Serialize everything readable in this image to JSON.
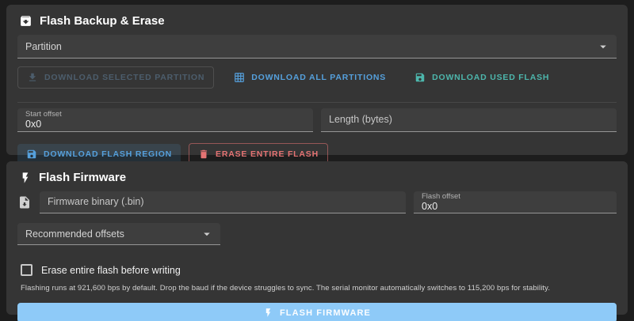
{
  "backup": {
    "title": "Flash Backup & Erase",
    "partition": {
      "label": "Partition"
    },
    "download_selected_label": "DOWNLOAD SELECTED PARTITION",
    "download_all_label": "DOWNLOAD ALL PARTITIONS",
    "download_used_label": "DOWNLOAD USED FLASH",
    "start_offset": {
      "label": "Start offset",
      "value": "0x0"
    },
    "length": {
      "placeholder": "Length (bytes)"
    },
    "download_region_label": "DOWNLOAD FLASH REGION",
    "erase_flash_label": "ERASE ENTIRE FLASH"
  },
  "firmware": {
    "title": "Flash Firmware",
    "binary": {
      "placeholder": "Firmware binary (.bin)"
    },
    "flash_offset": {
      "label": "Flash offset",
      "value": "0x0"
    },
    "recommended_offsets": {
      "label": "Recommended offsets"
    },
    "erase_before_write": {
      "label": "Erase entire flash before writing",
      "checked": false
    },
    "help_text": "Flashing runs at 921,600 bps by default. Drop the baud if the device struggles to sync. The serial monitor automatically switches to 115,200 bps for stability.",
    "flash_button_label": "FLASH FIRMWARE"
  },
  "colors": {
    "accent_blue": "#55a0dc",
    "teal": "#4db6ac",
    "danger": "#e57373",
    "flash_button_bg": "#8ecaf8",
    "card_bg": "#353535",
    "page_bg": "#1d1d1d"
  },
  "icons": {
    "archive": "archive-box-with-down-arrow",
    "download": "arrow-down-to-tray",
    "grid": "partition-grid",
    "save": "floppy-disk",
    "delete": "trash-can",
    "bolt": "lightning-bolt",
    "file": "binary-file-with-down-arrow",
    "dropdown": "caret-down"
  }
}
